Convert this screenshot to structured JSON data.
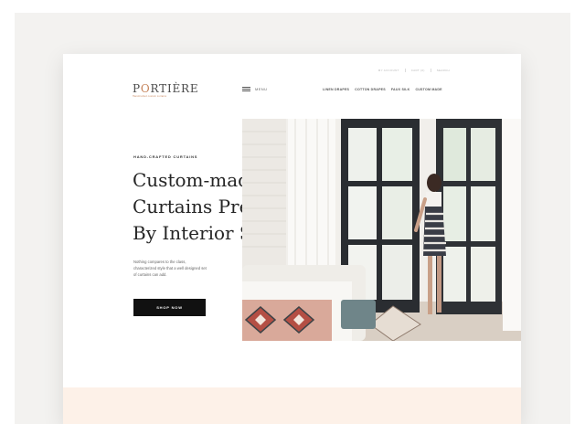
{
  "utility": {
    "items": [
      "MY ACCOUNT",
      "CART (0)",
      "SEARCH"
    ]
  },
  "logo": {
    "brand_prefix": "P",
    "brand_accent": "O",
    "brand_suffix": "RTIÈRE",
    "tagline": "Handcrafted custom curtains"
  },
  "menu": {
    "label": "MENU"
  },
  "nav": {
    "items": [
      "LINEN DRAPES",
      "COTTON DRAPES",
      "FAUX SILK",
      "CUSTOM MADE"
    ]
  },
  "hero": {
    "eyebrow": "HAND-CRAFTED CURTAINS",
    "headline_lines": [
      "Custom-made",
      "Curtains Preferred",
      "By Interior Stylists"
    ],
    "body_lines": [
      "Nothing compares to the class,",
      "characterized style that a well designed set",
      "of curtains can add."
    ],
    "cta_label": "SHOP NOW"
  },
  "icons": {
    "menu": "hamburger-icon"
  },
  "colors": {
    "accent": "#c6845b",
    "cta_bg": "#111111",
    "bottom_band": "#fdf1e8",
    "outer_bg": "#f3f2f0"
  }
}
